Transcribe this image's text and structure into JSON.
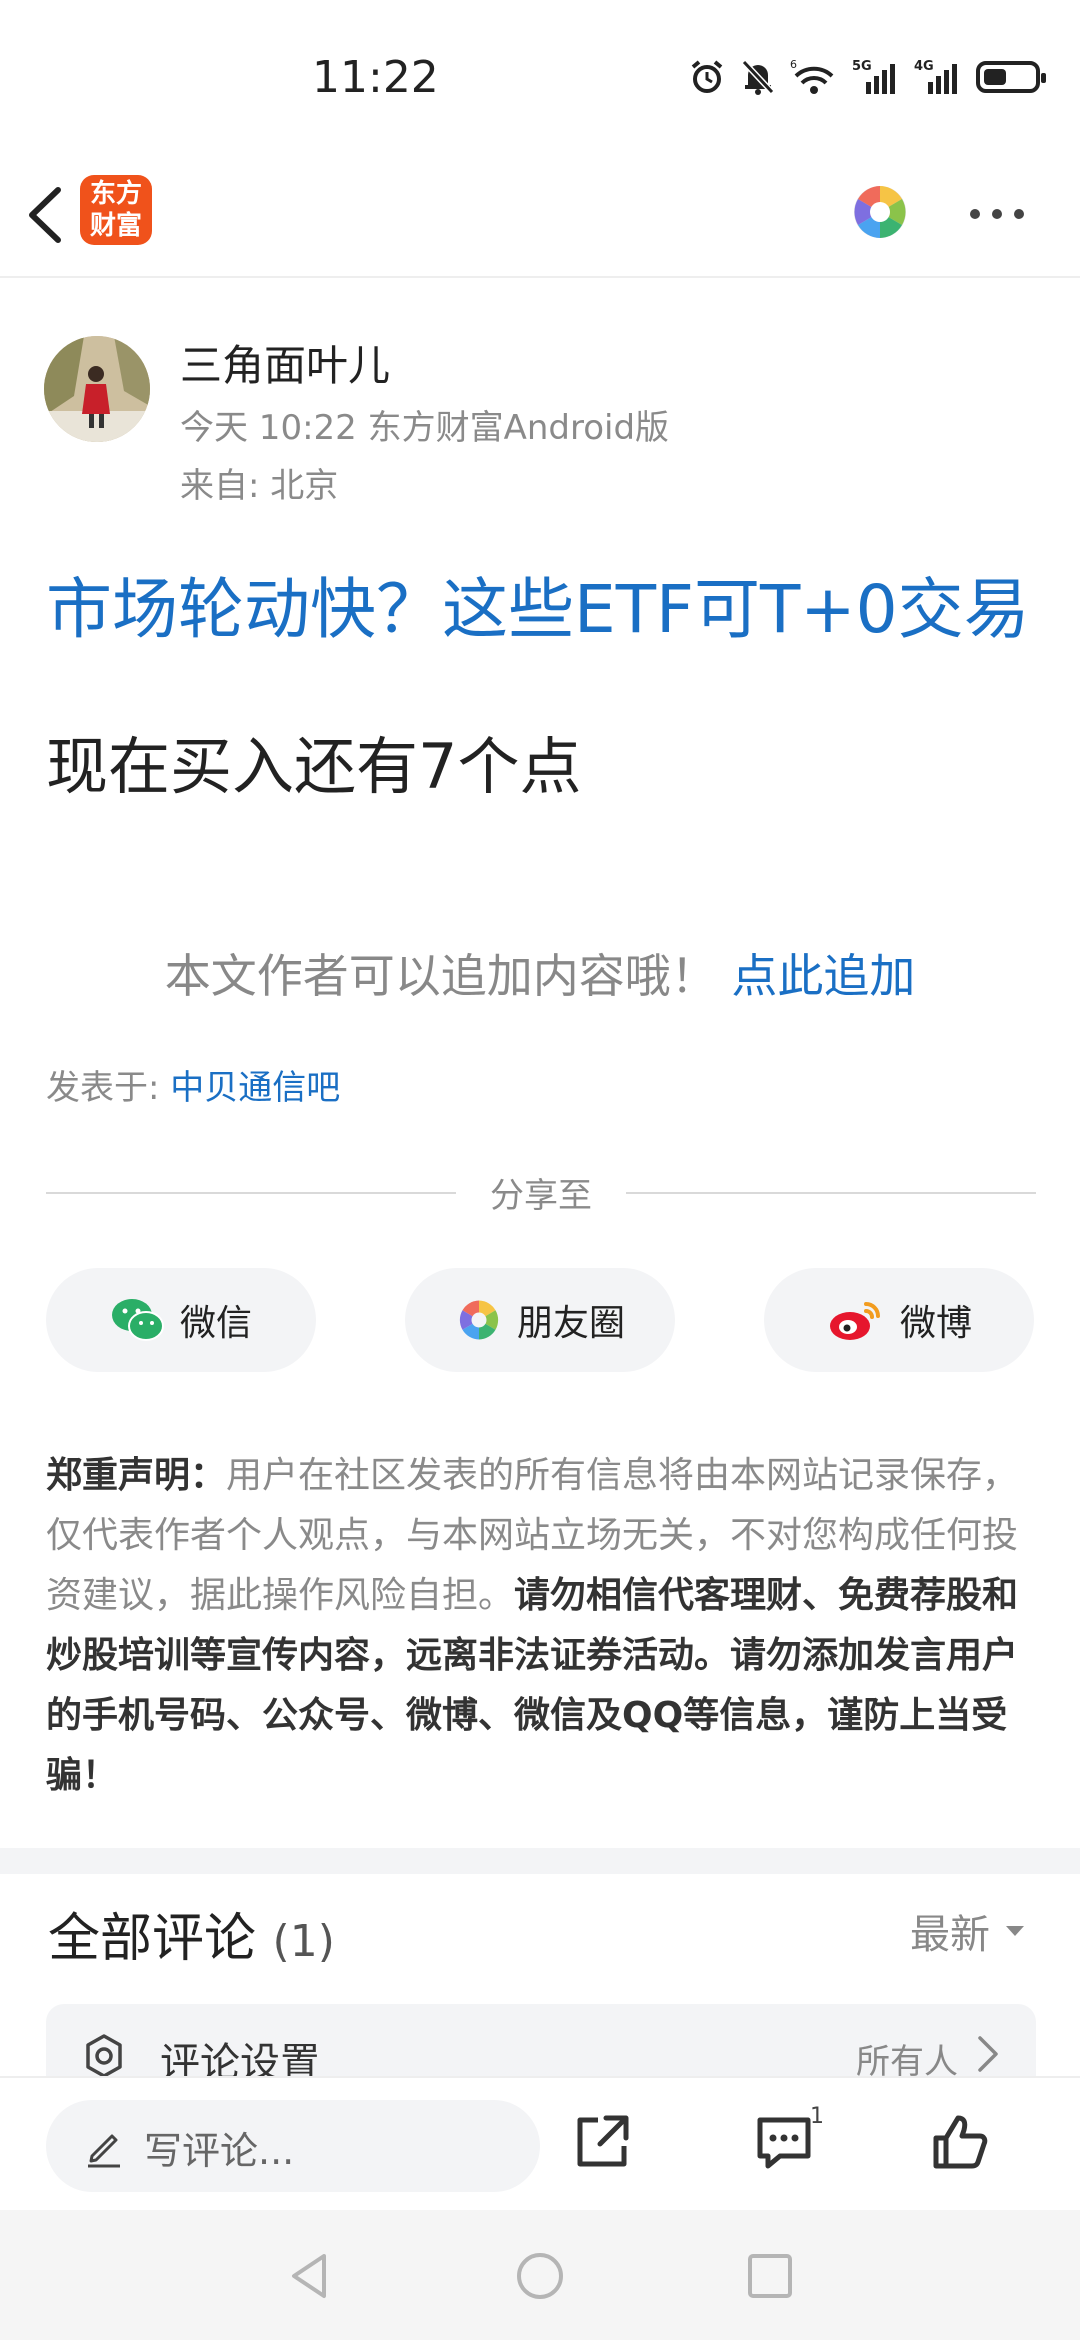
{
  "status_bar": {
    "time": "11:22",
    "battery_level": 0.45,
    "net1": "5G",
    "net2": "4G",
    "wifi_tag": "6"
  },
  "header": {
    "logo_line1": "东方",
    "logo_line2": "财富"
  },
  "author": {
    "name": "三角面叶儿",
    "meta": "今天 10:22 东方财富Android版",
    "location": "来自: 北京"
  },
  "post": {
    "title": "市场轮动快？这些ETF可T+0交易",
    "body": "现在买入还有7个点",
    "append_prompt": "本文作者可以追加内容哦！",
    "append_link": "点此追加",
    "posted_in_label": "发表于: ",
    "posted_in_bar": "中贝通信吧"
  },
  "share": {
    "label": "分享至",
    "wechat": "微信",
    "moments": "朋友圈",
    "weibo": "微博"
  },
  "disclaimer": {
    "title": "郑重声明",
    "colon": "：",
    "normal": "用户在社区发表的所有信息将由本网站记录保存，仅代表作者个人观点，与本网站立场无关，不对您构成任何投资建议，据此操作风险自担。",
    "bold": "请勿相信代客理财、免费荐股和炒股培训等宣传内容，远离非法证券活动。请勿添加发言用户的手机号码、公众号、微博、微信及QQ等信息，谨防上当受骗！"
  },
  "comments": {
    "title": "全部评论",
    "count": "(1)",
    "sort": "最新",
    "settings_label": "评论设置",
    "settings_value": "所有人"
  },
  "action_bar": {
    "placeholder": "写评论...",
    "comment_badge": "1"
  },
  "colors": {
    "link": "#1a6fc4",
    "brand": "#f0521b",
    "wechat": "#2aae67",
    "weibo": "#e6162d"
  }
}
